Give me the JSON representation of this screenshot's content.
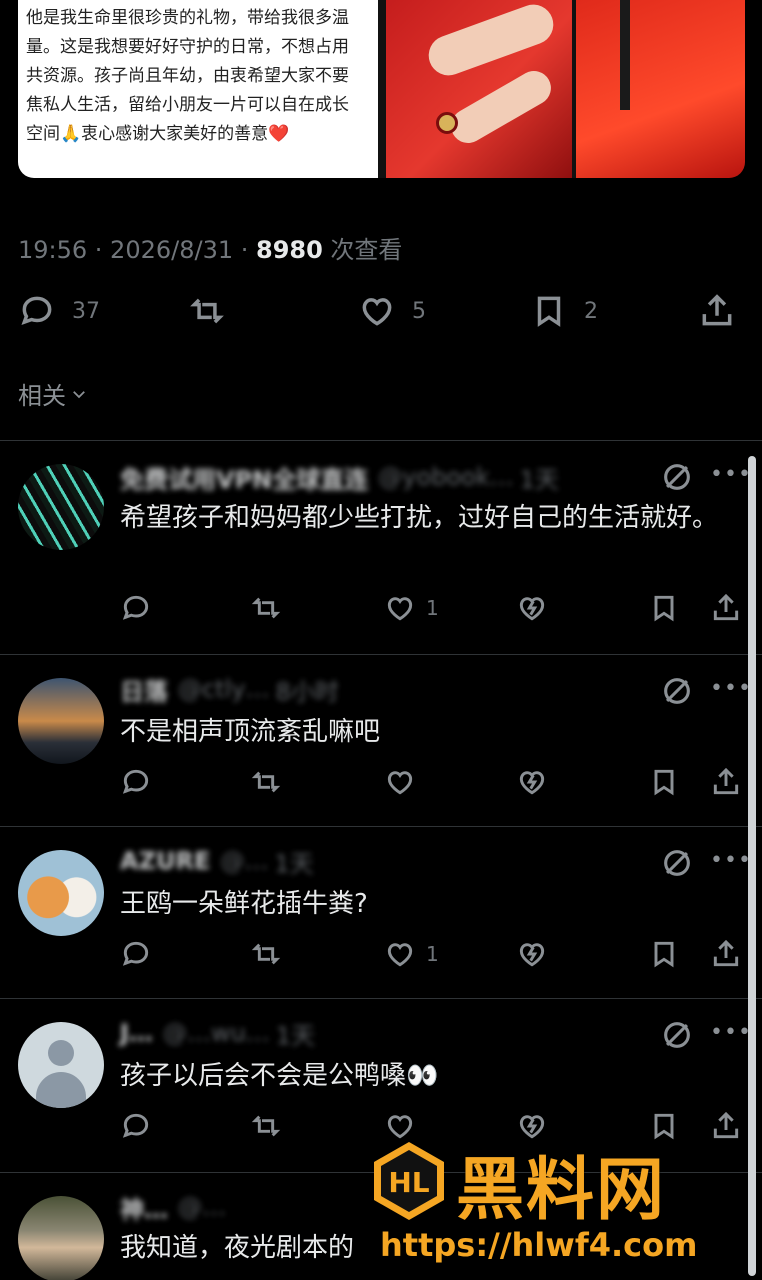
{
  "post": {
    "text_lines": [
      "他是我生命里很珍贵的礼物，带给我很多温",
      "量。这是我想要好好守护的日常，不想占用",
      "共资源。孩子尚且年幼，由衷希望大家不要",
      "焦私人生活，留给小朋友一片可以自在成长",
      "空间🙏衷心感谢大家美好的善意❤️"
    ],
    "time": "19:56 · 2026/8/31 · ",
    "views": "8980",
    "views_label": " 次查看",
    "replies": "37",
    "likes": "5",
    "bookmarks": "2"
  },
  "related_label": "相关",
  "replies": [
    {
      "name": "免费试用VPN全球直连",
      "handle": "@yobook…",
      "time": "1天",
      "text": "希望孩子和妈妈都少些打扰，过好自己的生活就好。",
      "likes": "1"
    },
    {
      "name": "日落",
      "handle": "@ctly…",
      "time": "8小时",
      "text": "不是相声顶流紊乱嘛吧",
      "likes": ""
    },
    {
      "name": "AZURE",
      "handle": "@…",
      "time": "1天",
      "text": "王鸥一朵鲜花插牛粪?",
      "likes": "1"
    },
    {
      "name": "J…",
      "handle": "@…wu…",
      "time": "1天",
      "text": "孩子以后会不会是公鸭嗓👀",
      "likes": ""
    },
    {
      "name": "神…",
      "handle": "@…",
      "time": "",
      "text": "我知道，夜光剧本的",
      "likes": ""
    }
  ],
  "watermark": {
    "title": "黑料网",
    "url": "https://hlwf4.com"
  },
  "icons": [
    "reply-icon",
    "retweet-icon",
    "heart-icon",
    "bookmark-icon",
    "share-icon",
    "grok-icon",
    "more-icon",
    "chevron-down-icon",
    "views-icon"
  ],
  "colors": {
    "background": "#000000",
    "muted": "#71767b",
    "text": "#e7e9ea",
    "watermark": "#f5a623"
  }
}
